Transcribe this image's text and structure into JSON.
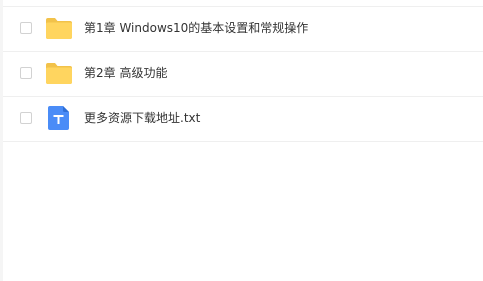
{
  "files": [
    {
      "name": "第1章 Windows10的基本设置和常规操作",
      "icon": "folder-icon",
      "checked": false
    },
    {
      "name": "第2章 高级功能",
      "icon": "folder-icon",
      "checked": false
    },
    {
      "name": "更多资源下载地址.txt",
      "icon": "text-file-icon",
      "checked": false
    }
  ],
  "colors": {
    "folder": "#FFD55F",
    "folder_tab": "#F2C24A",
    "txt_icon": "#4A8CF7"
  }
}
